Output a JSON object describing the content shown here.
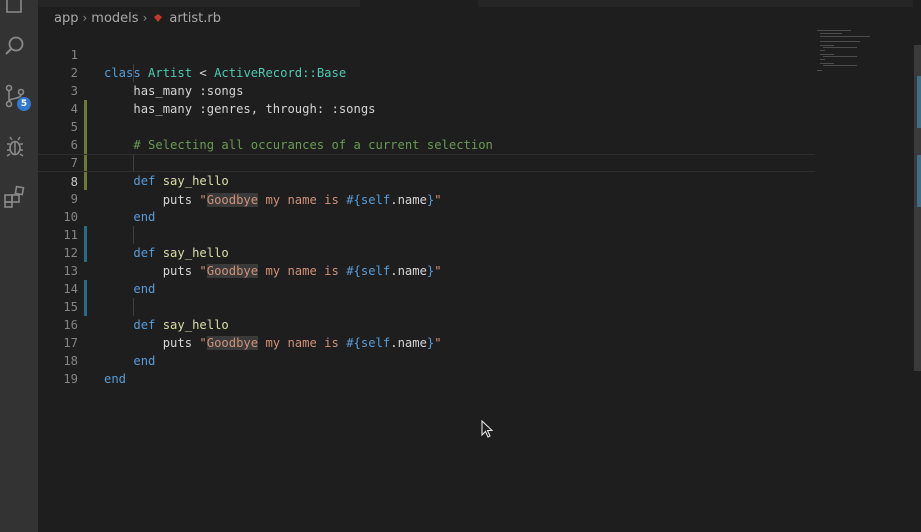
{
  "breadcrumb": {
    "items": [
      "app",
      "models",
      "artist.rb"
    ],
    "file_icon": "ruby-gem-icon"
  },
  "activity_bar": {
    "icons": [
      "explorer-icon",
      "search-icon",
      "source-control-icon",
      "debug-icon",
      "extensions-icon"
    ],
    "source_control_badge": "5"
  },
  "editor": {
    "active_line": 8,
    "lines": [
      {
        "n": "1"
      },
      {
        "n": "2"
      },
      {
        "n": "3"
      },
      {
        "n": "4"
      },
      {
        "n": "5"
      },
      {
        "n": "6"
      },
      {
        "n": "7"
      },
      {
        "n": "8"
      },
      {
        "n": "9"
      },
      {
        "n": "10"
      },
      {
        "n": "11"
      },
      {
        "n": "12"
      },
      {
        "n": "13"
      },
      {
        "n": "14"
      },
      {
        "n": "15"
      },
      {
        "n": "16"
      },
      {
        "n": "17"
      },
      {
        "n": "18"
      },
      {
        "n": "19"
      }
    ],
    "tokens": {
      "class_kw": "class",
      "class_name": "Artist",
      "lt": "<",
      "base_class": "ActiveRecord::Base",
      "has_many": "has_many",
      "songs_sym": ":songs",
      "genres_sym": ":genres,",
      "through": "through:",
      "comment": "# Selecting all occurances of a current selection",
      "def_kw": "def",
      "method": "say_hello",
      "puts": "puts",
      "quote": "\"",
      "goodbye": "Goodbye",
      "str_rest": " my name is ",
      "interp_open": "#{",
      "self_kw": "self",
      "dot_name": ".name",
      "interp_close": "}",
      "end_kw": "end"
    }
  },
  "colors": {
    "keyword": "#569cd6",
    "class": "#4ec9b0",
    "function": "#dcdcaa",
    "string": "#ce9178",
    "comment": "#6a9955",
    "modified_gutter": "#6b7a35",
    "added_gutter": "#2a6a8a",
    "badge": "#2f7ad0"
  }
}
